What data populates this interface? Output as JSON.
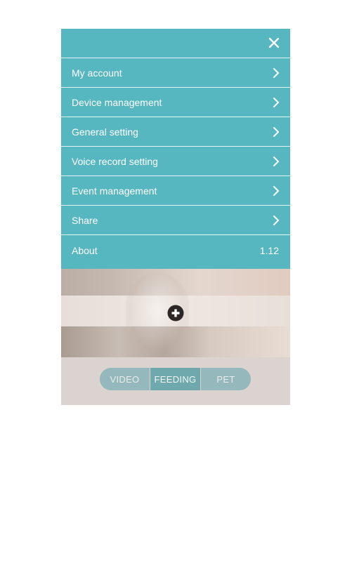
{
  "menu": {
    "close_icon": "close-icon",
    "items": [
      {
        "label": "My account",
        "icon": "chevron-right-icon"
      },
      {
        "label": "Device management",
        "icon": "chevron-right-icon"
      },
      {
        "label": "General setting",
        "icon": "chevron-right-icon"
      },
      {
        "label": "Voice record setting",
        "icon": "chevron-right-icon"
      },
      {
        "label": "Event management",
        "icon": "chevron-right-icon"
      },
      {
        "label": "Share",
        "icon": "chevron-right-icon"
      }
    ],
    "about": {
      "label": "About",
      "version": "1.12"
    }
  },
  "camera": {
    "add_icon": "plus-circle-icon"
  },
  "tabs": [
    {
      "label": "VIDEO"
    },
    {
      "label": "FEEDING",
      "selected": true
    },
    {
      "label": "PET"
    }
  ],
  "colors": {
    "menu_background": "#56b7c0",
    "tab_background": "#94b8bb",
    "tab_active": "#6fa9ad"
  }
}
